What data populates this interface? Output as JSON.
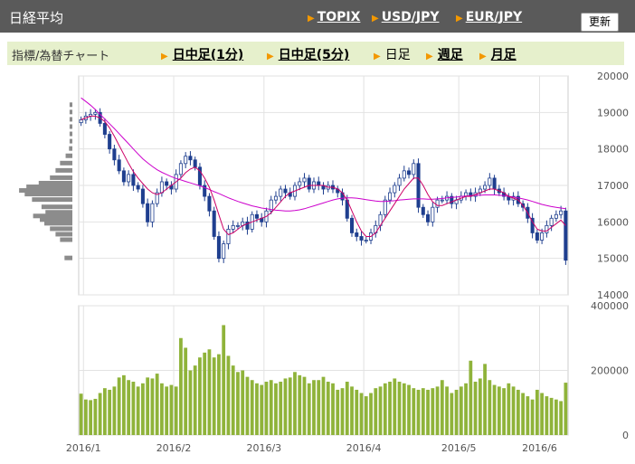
{
  "header": {
    "title": "日経平均",
    "links": [
      "TOPIX",
      "USD/JPY",
      "EUR/JPY"
    ],
    "update_button": "更新"
  },
  "timeframe_bar": {
    "label": "指標/為替チャート",
    "options": [
      {
        "label": "日中足(1分)",
        "link": true
      },
      {
        "label": "日中足(5分)",
        "link": true
      },
      {
        "label": "日足",
        "link": false
      },
      {
        "label": "週足",
        "link": true
      },
      {
        "label": "月足",
        "link": true
      }
    ]
  },
  "colors": {
    "up_candle": "#ffffff",
    "down_candle": "#1f3f8f",
    "moving_avg_short": "#cc0066",
    "moving_avg_long": "#cc00cc",
    "volume_bar": "#8fb33a",
    "volume_profile": "#8c8c8c"
  },
  "chart_data": [
    {
      "type": "candlestick",
      "title": "",
      "ylim": [
        14000,
        20000
      ],
      "y_ticks": [
        14000,
        15000,
        16000,
        17000,
        18000,
        19000,
        20000
      ],
      "x_ticks": [
        "2016/1",
        "2016/2",
        "2016/3",
        "2016/4",
        "2016/5",
        "2016/6"
      ],
      "close": [
        18800,
        18900,
        18950,
        19000,
        18700,
        18400,
        18000,
        17700,
        17400,
        17100,
        17300,
        17000,
        16900,
        16500,
        16000,
        16500,
        16800,
        17100,
        17000,
        16900,
        17300,
        17600,
        17800,
        17700,
        17500,
        17000,
        16700,
        16300,
        15600,
        15000,
        15400,
        15800,
        15900,
        15900,
        16000,
        15800,
        16200,
        16100,
        16000,
        16300,
        16600,
        16700,
        16900,
        16800,
        16700,
        17000,
        17100,
        17200,
        16900,
        17100,
        17000,
        16900,
        17000,
        16900,
        16800,
        16600,
        16100,
        15700,
        15600,
        15500,
        15500,
        15700,
        15900,
        16200,
        16600,
        16800,
        17000,
        17200,
        17400,
        17300,
        17600,
        16400,
        16200,
        16000,
        16400,
        16600,
        16600,
        16700,
        16500,
        16600,
        16700,
        16800,
        16700,
        16800,
        16900,
        17000,
        17200,
        16900,
        16800,
        16700,
        16600,
        16700,
        16500,
        16400,
        16100,
        15700,
        15500,
        15700,
        15900,
        16100,
        16200,
        16300,
        14950
      ],
      "series": [
        {
          "name": "",
          "type": "line",
          "values": [
            19400,
            19300,
            19200,
            19080,
            18950,
            18820,
            18690,
            18560,
            18420,
            18280,
            18140,
            18000,
            17860,
            17730,
            17620,
            17520,
            17430,
            17360,
            17300,
            17240,
            17190,
            17150,
            17110,
            17070,
            17030,
            16990,
            16940,
            16890,
            16830,
            16780,
            16720,
            16660,
            16610,
            16560,
            16520,
            16480,
            16440,
            16410,
            16380,
            16360,
            16340,
            16320,
            16310,
            16300,
            16300,
            16310,
            16330,
            16360,
            16400,
            16440,
            16480,
            16520,
            16560,
            16600,
            16630,
            16650,
            16660,
            16660,
            16650,
            16630,
            16610,
            16590,
            16570,
            16560,
            16560,
            16570,
            16580,
            16600,
            16610,
            16620,
            16630,
            16630,
            16630,
            16620,
            16620,
            16630,
            16640,
            16660,
            16670,
            16680,
            16700,
            16710,
            16720,
            16730,
            16730,
            16740,
            16740,
            16740,
            16730,
            16720,
            16700,
            16680,
            16660,
            16630,
            16600,
            16560,
            16520,
            16480,
            16450,
            16420,
            16400,
            16380,
            16360
          ]
        },
        {
          "name": "",
          "type": "line",
          "values": [
            18800,
            18850,
            18900,
            18900,
            18850,
            18750,
            18580,
            18350,
            18100,
            17850,
            17600,
            17380,
            17200,
            17050,
            16900,
            16800,
            16750,
            16800,
            16900,
            17000,
            17100,
            17200,
            17350,
            17450,
            17500,
            17400,
            17200,
            16950,
            16600,
            16200,
            15800,
            15650,
            15700,
            15800,
            15900,
            15950,
            16000,
            16050,
            16100,
            16150,
            16250,
            16400,
            16550,
            16700,
            16800,
            16850,
            16900,
            16950,
            17000,
            17000,
            17000,
            17000,
            16950,
            16950,
            16900,
            16800,
            16600,
            16300,
            16000,
            15750,
            15600,
            15600,
            15700,
            15900,
            16100,
            16300,
            16500,
            16700,
            16900,
            17050,
            17200,
            17200,
            17000,
            16750,
            16550,
            16450,
            16450,
            16500,
            16550,
            16600,
            16650,
            16700,
            16700,
            16750,
            16800,
            16850,
            16900,
            16900,
            16850,
            16800,
            16700,
            16650,
            16600,
            16450,
            16250,
            16000,
            15800,
            15750,
            15750,
            15850,
            15950,
            16050,
            15900
          ]
        }
      ],
      "volume_profile": [
        [
          15000,
          0.14
        ],
        [
          15500,
          0.22
        ],
        [
          15650,
          0.3
        ],
        [
          15800,
          0.4
        ],
        [
          15950,
          0.5
        ],
        [
          16050,
          0.58
        ],
        [
          16150,
          0.7
        ],
        [
          16250,
          0.48
        ],
        [
          16400,
          0.55
        ],
        [
          16600,
          0.72
        ],
        [
          16750,
          0.85
        ],
        [
          16850,
          0.95
        ],
        [
          16950,
          0.82
        ],
        [
          17050,
          0.6
        ],
        [
          17200,
          0.4
        ],
        [
          17400,
          0.3
        ],
        [
          17600,
          0.22
        ],
        [
          17800,
          0.12
        ],
        [
          18000,
          0.06
        ],
        [
          18200,
          0.05
        ],
        [
          18400,
          0.05
        ],
        [
          18600,
          0.05
        ],
        [
          18800,
          0.05
        ],
        [
          19000,
          0.05
        ],
        [
          19200,
          0.05
        ]
      ]
    },
    {
      "type": "bar",
      "title": "",
      "ylim": [
        0,
        400000
      ],
      "y_ticks": [
        0,
        200000,
        400000
      ],
      "values": [
        128000,
        110000,
        108000,
        112000,
        130000,
        145000,
        140000,
        150000,
        178000,
        185000,
        170000,
        165000,
        150000,
        160000,
        178000,
        175000,
        190000,
        160000,
        150000,
        155000,
        150000,
        300000,
        270000,
        200000,
        215000,
        240000,
        255000,
        265000,
        240000,
        250000,
        340000,
        245000,
        215000,
        195000,
        200000,
        180000,
        170000,
        160000,
        155000,
        165000,
        170000,
        160000,
        165000,
        175000,
        178000,
        195000,
        185000,
        180000,
        160000,
        170000,
        170000,
        180000,
        165000,
        160000,
        140000,
        145000,
        165000,
        150000,
        140000,
        130000,
        120000,
        130000,
        145000,
        150000,
        160000,
        165000,
        175000,
        165000,
        160000,
        155000,
        145000,
        140000,
        145000,
        140000,
        145000,
        150000,
        170000,
        150000,
        130000,
        140000,
        150000,
        160000,
        230000,
        165000,
        175000,
        220000,
        170000,
        155000,
        150000,
        145000,
        160000,
        150000,
        140000,
        130000,
        120000,
        110000,
        140000,
        130000,
        120000,
        115000,
        110000,
        105000,
        162000
      ],
      "x_ticks": [
        "2016/1",
        "2016/2",
        "2016/3",
        "2016/4",
        "2016/5",
        "2016/6"
      ]
    }
  ]
}
